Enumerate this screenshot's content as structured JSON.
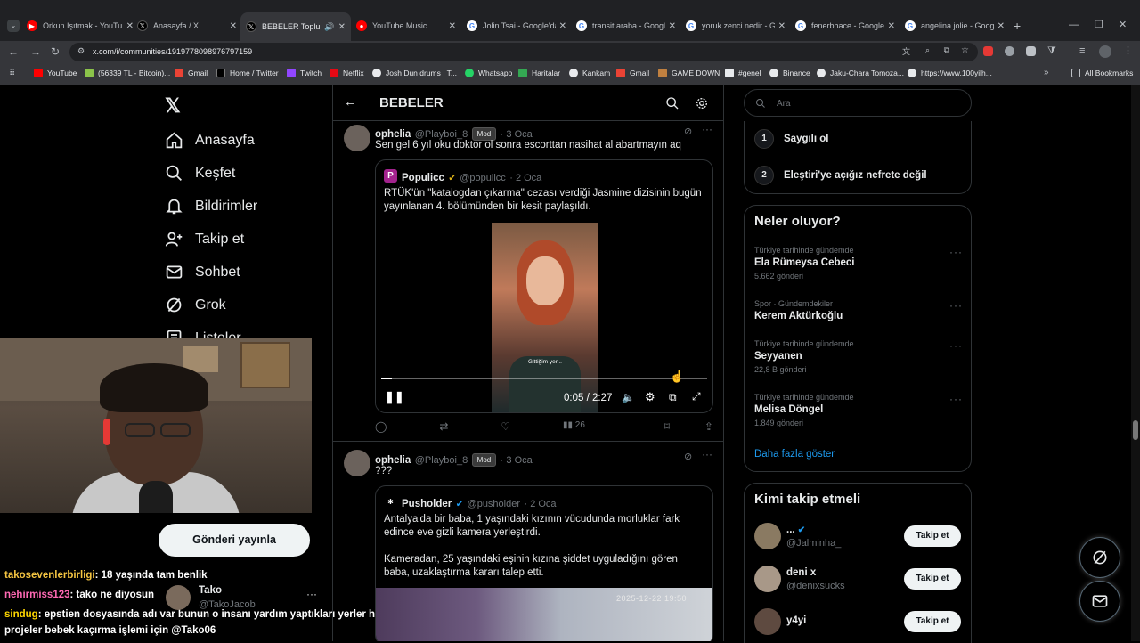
{
  "browser": {
    "tabs": [
      {
        "title": "Orkun Işıtmak - YouTu",
        "color": "#ff0000"
      },
      {
        "title": "Anasayfa / X",
        "color": "#000000"
      },
      {
        "title": "BEBELER Topluluk",
        "color": "#000000"
      },
      {
        "title": "YouTube Music",
        "color": "#ff0000"
      },
      {
        "title": "Jolin Tsai - Google'da",
        "color": "#4285f4"
      },
      {
        "title": "transit araba - Googl",
        "color": "#4285f4"
      },
      {
        "title": "yoruk zenci nedir - G",
        "color": "#4285f4"
      },
      {
        "title": "fenerbhace - Google",
        "color": "#4285f4"
      },
      {
        "title": "angelina jolie - Goog",
        "color": "#4285f4"
      }
    ],
    "url": "x.com/i/communities/1919778098976797159",
    "bookmarks": [
      "YouTube",
      "(56339 TL - Bitcoin)...",
      "Gmail",
      "Home / Twitter",
      "Twitch",
      "Netflix",
      "Josh Dun drums | T...",
      "Whatsapp",
      "Haritalar",
      "Kankam",
      "Gmail",
      "GAME DOWN",
      "#genel",
      "Binance",
      "Jaku-Chara Tomoza...",
      "https://www.100yilh..."
    ],
    "all_bookmarks": "All Bookmarks"
  },
  "nav": {
    "items": [
      "Anasayfa",
      "Keşfet",
      "Bildirimler",
      "Takip et",
      "Sohbet",
      "Grok",
      "Listeler"
    ],
    "post_button": "Gönderi yayınla"
  },
  "chat": {
    "lines": [
      {
        "user": "takosevenlerbirligi",
        "msg": ": 18 yaşında tam benlik",
        "color": "#f5c542"
      },
      {
        "user": "nehirmiss123",
        "msg": ": tako ne diyosun",
        "color": "#ff69b4"
      },
      {
        "user": "sindug",
        "msg": ": epstien dosyasında adı var bunun o insanı yardım yaptıkları yerler hep",
        "color": "#ffd700"
      },
      {
        "user": "",
        "msg": "projeler bebek kaçırma işlemi için @Tako06",
        "color": "#ffffff"
      }
    ],
    "account_name": "Tako",
    "account_handle": "@TakoJacob"
  },
  "community": {
    "title": "BEBELER"
  },
  "posts": [
    {
      "name": "ophelia",
      "handle": "@Playboi_8",
      "badge": "Mod",
      "date": "· 3 Oca",
      "text": "Sen gel 6 yıl oku doktor ol sonra escorttan nasihat al abartmayın aq",
      "quote": {
        "name": "Populicc",
        "handle": "@populicc",
        "date": "· 2 Oca",
        "text": "RTÜK'ün \"katalogdan çıkarma\" cezası verdiği Jasmine dizisinin bugün yayınlanan 4. bölümünden bir kesit paylaşıldı.",
        "video_time": "0:05 / 2:27",
        "video_caption": "Gittiğim yer...",
        "progress_fraction": 0.033
      },
      "views": "26"
    },
    {
      "name": "ophelia",
      "handle": "@Playboi_8",
      "badge": "Mod",
      "date": "· 3 Oca",
      "text": "???",
      "quote": {
        "name": "Pusholder",
        "handle": "@pusholder",
        "date": "· 2 Oca",
        "text1": "Antalya'da bir baba, 1 yaşındaki kızının vücudunda morluklar fark edince eve gizli kamera yerleştirdi.",
        "text2": "Kameradan, 25 yaşındaki eşinin kızına şiddet uyguladığını gören baba, uzaklaştırma kararı talep etti.",
        "cam_timestamp": "2025-12-22 19:50"
      }
    }
  ],
  "right": {
    "search_placeholder": "Ara",
    "rules": [
      {
        "num": "1",
        "text": "Saygılı ol"
      },
      {
        "num": "2",
        "text": "Eleştiri'ye açığız nefrete değil"
      }
    ],
    "trends_title": "Neler oluyor?",
    "trends": [
      {
        "context": "Türkiye tarihinde gündemde",
        "title": "Ela Rümeysa Cebeci",
        "count": "5.662 gönderi"
      },
      {
        "context": "Spor · Gündemdekiler",
        "title": "Kerem Aktürkoğlu",
        "count": ""
      },
      {
        "context": "Türkiye tarihinde gündemde",
        "title": "Seyyanen",
        "count": "22,8 B gönderi"
      },
      {
        "context": "Türkiye tarihinde gündemde",
        "title": "Melisa Döngel",
        "count": "1.849 gönderi"
      }
    ],
    "show_more": "Daha fazla göster",
    "who_to_follow_title": "Kimi takip etmeli",
    "follow": [
      {
        "name": "...",
        "handle": "@Jalminha_",
        "button": "Takip et"
      },
      {
        "name": "deni x",
        "handle": "@denixsucks",
        "button": "Takip et"
      },
      {
        "name": "y4yi",
        "handle": "",
        "button": "Takip et"
      }
    ]
  },
  "colors": {
    "accent": "#1d9bf0",
    "background": "#000000",
    "border": "#2f3336",
    "muted": "#71767b"
  }
}
